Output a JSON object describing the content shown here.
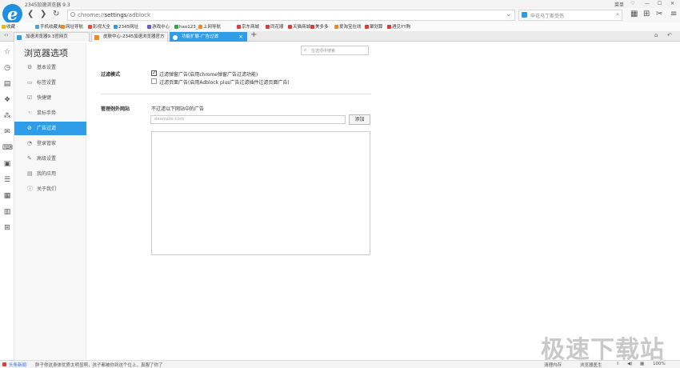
{
  "window": {
    "title": "2345加速浏览器 9.3",
    "controls": [
      "菜单",
      "♡",
      "—",
      "☐",
      "✕"
    ]
  },
  "toolbar": {
    "back": "❮",
    "forward": "❯",
    "refresh": "↻",
    "home": "⌂",
    "url_prefix": "chrome://",
    "url_path": "settings",
    "url_suffix": "/adblock",
    "search_placeholder": "申花马丁斯受伤"
  },
  "bookmarks": [
    {
      "label": "收藏 ·",
      "color": "#f5b400"
    },
    {
      "label": "手机收藏夹",
      "color": "#4aa3df"
    },
    {
      "label": "网址导航",
      "color": "#f08a24"
    },
    {
      "label": "影视大全",
      "color": "#e64b3c"
    },
    {
      "label": "2345网址",
      "color": "#2e9ce6"
    },
    {
      "label": "游戏中心",
      "color": "#6a5acd"
    },
    {
      "label": "hao123_上",
      "color": "#2eaa4a"
    },
    {
      "label": "上网导航",
      "color": "#f08a24"
    },
    {
      "label": "京东商城",
      "color": "#e4393c"
    },
    {
      "label": "同花顺",
      "color": "#e4393c"
    },
    {
      "label": "天猫商城",
      "color": "#e4393c"
    },
    {
      "label": "美多多",
      "color": "#e4393c"
    },
    {
      "label": "爱淘宝在线",
      "color": "#f08a24"
    },
    {
      "label": "聚划算",
      "color": "#e4393c"
    },
    {
      "label": "遇见YY购",
      "color": "#e4393c"
    }
  ],
  "tabs": [
    {
      "label": "加速浏览器9.3官网页",
      "color": "#2e9ce6",
      "active": false
    },
    {
      "label": "皮肤中心-2345加速浏览器官方",
      "color": "#f08a24",
      "active": false
    },
    {
      "label": "功能扩展-广告过滤",
      "color": "#ffffff",
      "active": true
    }
  ],
  "new_tab": "+",
  "left_icons": [
    "☆",
    "◷",
    "▤",
    "❖",
    "⁂",
    "✉",
    "⌨",
    "▣",
    "☰",
    "▦",
    "▥",
    "⊞"
  ],
  "settings": {
    "title": "浏览器选项",
    "search_placeholder": "在选项中搜索",
    "nav": [
      {
        "label": "基本设置",
        "icon": "⚙",
        "active": false
      },
      {
        "label": "标签设置",
        "icon": "▭",
        "active": false
      },
      {
        "label": "快捷键",
        "icon": "☑",
        "active": false
      },
      {
        "label": "鼠标手势",
        "icon": "☜",
        "active": false
      },
      {
        "label": "广告过滤",
        "icon": "⊘",
        "active": true
      },
      {
        "label": "登录管家",
        "icon": "◔",
        "active": false
      },
      {
        "label": "高级设置",
        "icon": "✎",
        "active": false
      },
      {
        "label": "我的应用",
        "icon": "▤",
        "active": false
      },
      {
        "label": "关于我们",
        "icon": "ⓘ",
        "active": false
      }
    ]
  },
  "adblock": {
    "mode_label": "过滤模式",
    "option1": "过滤弹窗广告(启用chrome弹窗广告过滤功能)",
    "option1_checked": true,
    "option2": "过滤页面广告(启用Adblock plus广告过滤插件过滤页面广告)",
    "option2_checked": false,
    "manage_label": "管理例外网站",
    "manage_desc": "不过滤以下网站中的广告",
    "input_placeholder": "example.com",
    "add_button": "添加"
  },
  "statusbar": {
    "news": "头条新闻",
    "headline": "胖子你这身体优质太明显啊，孩子都被你到这个位上，真服了你了",
    "cleaner": "清理内存",
    "doctor": "浏览器医生",
    "zoom": "100%"
  },
  "watermark": "极速下载站"
}
